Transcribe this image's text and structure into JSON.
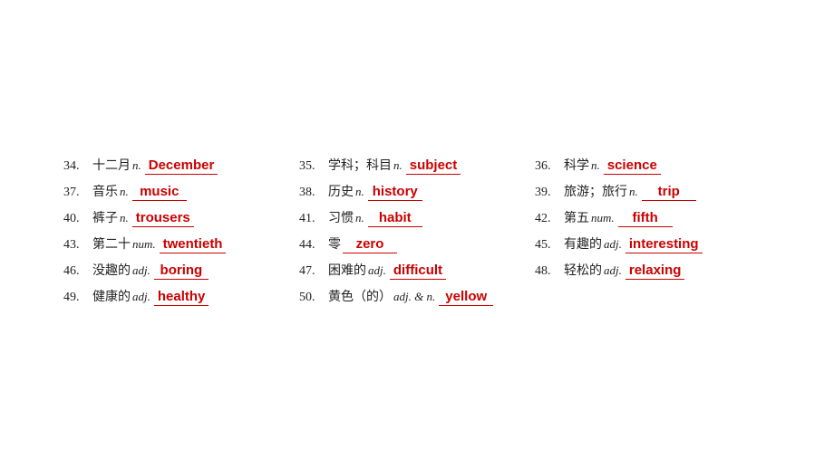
{
  "rows": [
    [
      {
        "num": "34.",
        "chinese": "十二月",
        "pos": "n.",
        "prefix": "",
        "answer": "December",
        "suffix": ""
      },
      {
        "num": "35.",
        "chinese": "学科；科目",
        "pos": "n.",
        "prefix": "",
        "answer": "subject",
        "suffix": ""
      },
      {
        "num": "36.",
        "chinese": "科学",
        "pos": "n.",
        "prefix": "",
        "answer": "science",
        "suffix": ""
      }
    ],
    [
      {
        "num": "37.",
        "chinese": "音乐",
        "pos": "n.",
        "prefix": "",
        "answer": "music",
        "suffix": ""
      },
      {
        "num": "38.",
        "chinese": "历史",
        "pos": "n.",
        "prefix": "",
        "answer": "history",
        "suffix": ""
      },
      {
        "num": "39.",
        "chinese": "旅游；旅行",
        "pos": "n.",
        "prefix": "",
        "answer": "trip",
        "suffix": ""
      }
    ],
    [
      {
        "num": "40.",
        "chinese": "裤子",
        "pos": "n.",
        "prefix": "",
        "answer": "trousers",
        "suffix": ""
      },
      {
        "num": "41.",
        "chinese": "习惯",
        "pos": "n.",
        "prefix": "",
        "answer": "habit",
        "suffix": ""
      },
      {
        "num": "42.",
        "chinese": "第五",
        "pos": "num.",
        "prefix": "",
        "answer": "fifth",
        "suffix": ""
      }
    ],
    [
      {
        "num": "43.",
        "chinese": "第二十",
        "pos": "num.",
        "prefix": "",
        "answer": "twentieth",
        "suffix": ""
      },
      {
        "num": "44.",
        "chinese": "零",
        "pos": "",
        "prefix": "",
        "answer": "zero",
        "suffix": ""
      },
      {
        "num": "45.",
        "chinese": "有趣的",
        "pos": "adj.",
        "prefix": "",
        "answer": "interesting",
        "suffix": ""
      }
    ],
    [
      {
        "num": "46.",
        "chinese": "没趣的",
        "pos": "adj.",
        "prefix": "",
        "answer": "boring",
        "suffix": ""
      },
      {
        "num": "47.",
        "chinese": "困难的",
        "pos": "adj.",
        "prefix": "",
        "answer": "difficult",
        "suffix": ""
      },
      {
        "num": "48.",
        "chinese": "轻松的",
        "pos": "adj.",
        "prefix": "",
        "answer": "relaxing",
        "suffix": ""
      }
    ],
    [
      {
        "num": "49.",
        "chinese": "健康的",
        "pos": "adj.",
        "prefix": "",
        "answer": "healthy",
        "suffix": ""
      },
      {
        "num": "50.",
        "chinese": "黄色（的）",
        "pos": "adj. & n.",
        "prefix": "",
        "answer": "yellow",
        "suffix": ""
      },
      {
        "num": "",
        "chinese": "",
        "pos": "",
        "prefix": "",
        "answer": "",
        "suffix": ""
      }
    ]
  ]
}
